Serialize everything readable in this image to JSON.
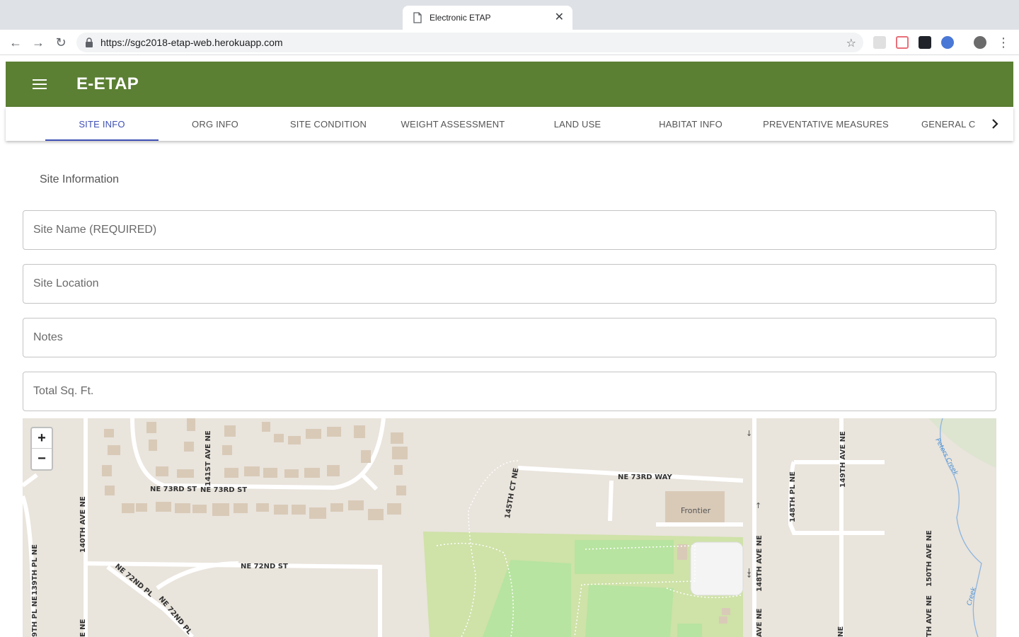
{
  "browser": {
    "tab_title": "Electronic ETAP",
    "url": "https://sgc2018-etap-web.herokuapp.com"
  },
  "app": {
    "title": "E-ETAP",
    "accent_color": "#5b7f33",
    "tab_active_color": "#3f51b5"
  },
  "tabs": [
    {
      "label": "SITE INFO",
      "active": true
    },
    {
      "label": "ORG INFO",
      "active": false
    },
    {
      "label": "SITE CONDITION",
      "active": false
    },
    {
      "label": "WEIGHT ASSESSMENT",
      "active": false
    },
    {
      "label": "LAND USE",
      "active": false
    },
    {
      "label": "HABITAT INFO",
      "active": false
    },
    {
      "label": "PREVENTATIVE MEASURES",
      "active": false
    },
    {
      "label": "GENERAL C",
      "active": false
    }
  ],
  "form": {
    "section_title": "Site Information",
    "site_name_placeholder": "Site Name (REQUIRED)",
    "site_location_placeholder": "Site Location",
    "notes_placeholder": "Notes",
    "total_sqft_placeholder": "Total Sq. Ft."
  },
  "map": {
    "zoom_in": "+",
    "zoom_out": "−",
    "streets": {
      "ne73rd_a": "NE 73RD ST",
      "ne73rd_b": "NE 73RD ST",
      "ne73rd_way": "NE 73RD WAY",
      "ne72nd_st": "NE 72ND ST",
      "ne72nd_pl_a": "NE 72ND PL",
      "ne72nd_pl_b": "NE 72ND PL",
      "ave141": "141ST AVE NE",
      "ave140": "140TH AVE NE",
      "pl139": "139TH PL NE",
      "ct145": "145TH CT NE",
      "ave148": "148TH AVE NE",
      "pl148": "148TH PL NE",
      "ave149": "149TH AVE NE",
      "ave150": "150TH AVE NE",
      "ave150_b": "TH AVE NE",
      "ave148_b": "AVE NE",
      "ave140_b": "E NE",
      "ave149_b": "NE",
      "pl139_b": "9TH PL NE"
    },
    "poi": "Frontier",
    "creek": "Peters Creek",
    "creek_b": "Creek"
  }
}
